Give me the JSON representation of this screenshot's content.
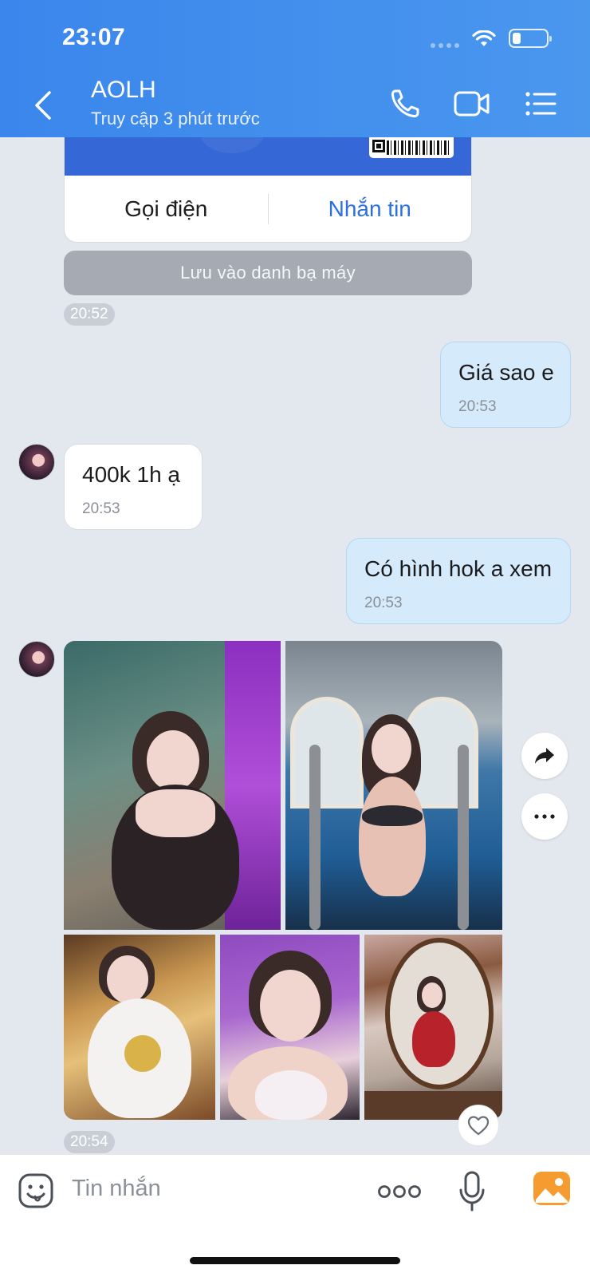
{
  "status_bar": {
    "time": "23:07"
  },
  "header": {
    "contact_name": "AOLH",
    "last_seen": "Truy cập 3 phút trước",
    "icons": [
      "back-chevron-icon",
      "phone-icon",
      "video-call-icon",
      "menu-list-icon"
    ]
  },
  "contact_card": {
    "call_label": "Gọi điện",
    "message_label": "Nhắn tin",
    "save_label": "Lưu vào danh bạ máy",
    "time": "20:52"
  },
  "messages": [
    {
      "direction": "out",
      "text": "Giá sao e",
      "time": "20:53"
    },
    {
      "direction": "in",
      "text": "400k 1h ạ",
      "time": "20:53"
    },
    {
      "direction": "out",
      "text": "Có hình hok a xem",
      "time": "20:53"
    }
  ],
  "photo_message": {
    "image_count": 5,
    "time": "20:54"
  },
  "input": {
    "placeholder": "Tin nhắn",
    "icons": [
      "sticker-icon",
      "more-icon",
      "microphone-icon",
      "gallery-icon"
    ]
  },
  "colors": {
    "header_blue": "#3a86ec",
    "outgoing_bubble": "#d5ebfb",
    "link_blue": "#2b6fe0",
    "gallery_orange": "#f59b2f"
  }
}
